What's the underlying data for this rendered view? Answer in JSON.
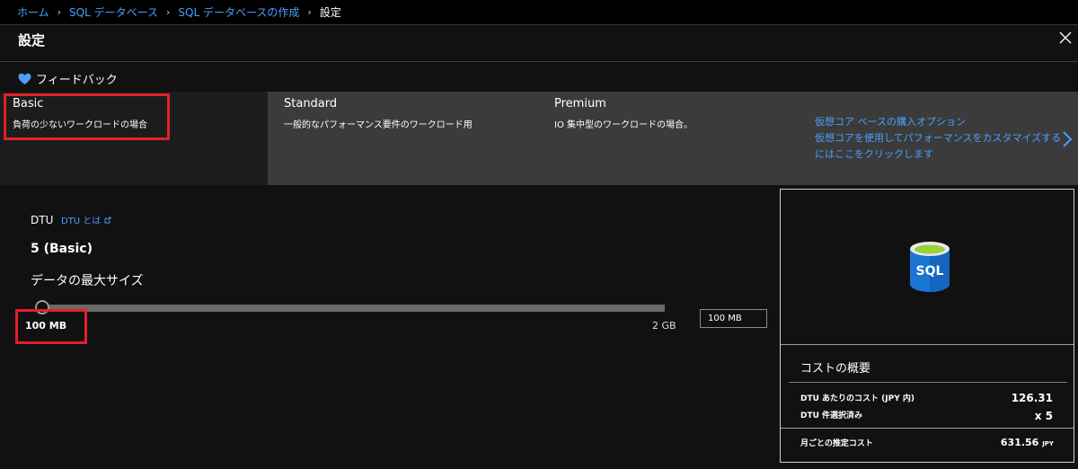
{
  "breadcrumb": {
    "items": [
      "ホーム",
      "SQL データベース",
      "SQL データベースの作成"
    ],
    "current": "設定",
    "separator": "›"
  },
  "title": "設定",
  "feedback": {
    "label": "フィードバック",
    "icon": "heart-icon",
    "color": "#4aa0ff"
  },
  "tiers": [
    {
      "name": "Basic",
      "description": "負荷の少ないワークロードの場合",
      "selected": true
    },
    {
      "name": "Standard",
      "description": "一般的なパフォーマンス要件のワークロード用",
      "selected": false
    },
    {
      "name": "Premium",
      "description": "IO 集中型のワークロードの場合。",
      "selected": false
    }
  ],
  "vcore": {
    "title": "仮想コア ベースの購入オプション",
    "text": "仮想コアを使用してパフォーマンスをカスタマイズするにはここをクリックします"
  },
  "dtu": {
    "label": "DTU",
    "link": "DTU とは",
    "value": "5 (Basic)"
  },
  "max_size": {
    "label": "データの最大サイズ",
    "min_label": "100 MB",
    "max_label": "2 GB",
    "input_value": "100 MB",
    "position": 0
  },
  "cost": {
    "title": "コストの概要",
    "rows": [
      {
        "label": "DTU あたりのコスト (JPY 内)",
        "value": "126.31"
      },
      {
        "label": "DTU 件選択済み",
        "value": "x 5"
      }
    ],
    "total_label": "月ごとの推定コスト",
    "total_value": "631.56",
    "total_unit": "JPY",
    "icon_text": "SQL"
  },
  "colors": {
    "accent": "#4aa0ff",
    "highlight_box": "#e2202a",
    "background": "#111111"
  }
}
